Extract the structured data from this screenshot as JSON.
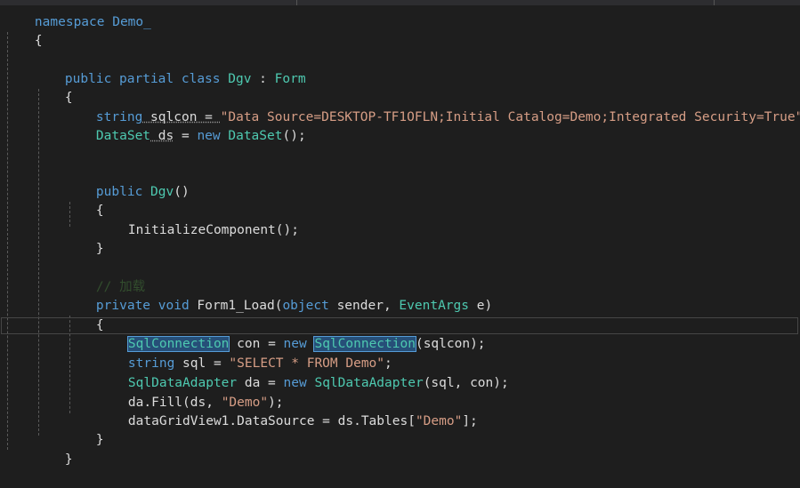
{
  "editor": {
    "lines": {
      "l0": "namespace Demo_",
      "l1": "{",
      "class_kw": "public partial class ",
      "class_name": "Dgv",
      "class_sep": " : ",
      "class_base": "Form",
      "open1": "{",
      "f1_type": "string",
      "f1_name": " sqlcon = ",
      "f1_value": "\"Data Source=DESKTOP-TF1OFLN;Initial Catalog=Demo;Integrated Security=True\"",
      "f1_end": ";",
      "f2_type": "DataSet",
      "f2_name": " ds",
      "f2_eq": " = ",
      "f2_new": "new",
      "f2_type2": " DataSet",
      "f2_end": "();",
      "ctor_kw": "public",
      "ctor_name": " Dgv",
      "ctor_end": "()",
      "ctor_open": "{",
      "ctor_body": "InitializeComponent();",
      "ctor_close": "}",
      "comment": "// 加载",
      "m_kw": "private void",
      "m_name": " Form1_Load(",
      "m_obj": "object",
      "m_sender": " sender, ",
      "m_args": "EventArgs",
      "m_e": " e)",
      "m_open": "{",
      "s1_type": "SqlConnection",
      "s1_mid": " con = ",
      "s1_new": "new",
      "s1_sp": " ",
      "s1_type2": "SqlConnection",
      "s1_end": "(sqlcon);",
      "s2_type": "string",
      "s2_mid": " sql = ",
      "s2_str": "\"SELECT * FROM Demo\"",
      "s2_end": ";",
      "s3_type": "SqlDataAdapter",
      "s3_mid": " da = ",
      "s3_new": "new",
      "s3_type2": " SqlDataAdapter",
      "s3_end": "(sql, con);",
      "s4_a": "da.Fill(ds, ",
      "s4_str": "\"Demo\"",
      "s4_end": ");",
      "s5_a": "dataGridView1.DataSource = ds.Tables[",
      "s5_str": "\"Demo\"",
      "s5_end": "];",
      "m_close": "}",
      "class_close": "}"
    }
  },
  "colors": {
    "background": "#1e1e1e",
    "keyword": "#569cd6",
    "type": "#4ec9b0",
    "string": "#d69d85",
    "text": "#dcdcdc"
  }
}
